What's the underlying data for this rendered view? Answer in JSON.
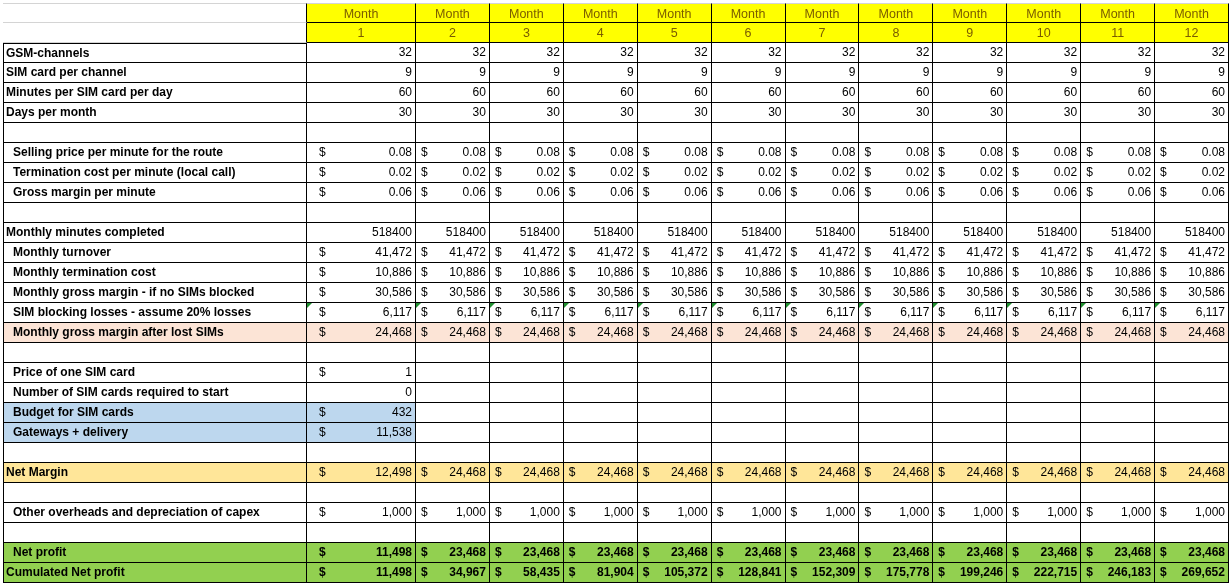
{
  "months": [
    {
      "label": "Month",
      "number": "1"
    },
    {
      "label": "Month",
      "number": "2"
    },
    {
      "label": "Month",
      "number": "3"
    },
    {
      "label": "Month",
      "number": "4"
    },
    {
      "label": "Month",
      "number": "5"
    },
    {
      "label": "Month",
      "number": "6"
    },
    {
      "label": "Month",
      "number": "7"
    },
    {
      "label": "Month",
      "number": "8"
    },
    {
      "label": "Month",
      "number": "9"
    },
    {
      "label": "Month",
      "number": "10"
    },
    {
      "label": "Month",
      "number": "11"
    },
    {
      "label": "Month",
      "number": "12"
    }
  ],
  "rows": [
    {
      "kind": "data",
      "label": "GSM-channels",
      "indent": false,
      "cells": [
        {
          "value": "32"
        },
        {
          "value": "32"
        },
        {
          "value": "32"
        },
        {
          "value": "32"
        },
        {
          "value": "32"
        },
        {
          "value": "32"
        },
        {
          "value": "32"
        },
        {
          "value": "32"
        },
        {
          "value": "32"
        },
        {
          "value": "32"
        },
        {
          "value": "32"
        },
        {
          "value": "32"
        }
      ]
    },
    {
      "kind": "data",
      "label": "SIM card per channel",
      "indent": false,
      "cells": [
        {
          "value": "9"
        },
        {
          "value": "9"
        },
        {
          "value": "9"
        },
        {
          "value": "9"
        },
        {
          "value": "9"
        },
        {
          "value": "9"
        },
        {
          "value": "9"
        },
        {
          "value": "9"
        },
        {
          "value": "9"
        },
        {
          "value": "9"
        },
        {
          "value": "9"
        },
        {
          "value": "9"
        }
      ]
    },
    {
      "kind": "data",
      "label": "Minutes per SIM card per day",
      "indent": false,
      "cells": [
        {
          "value": "60"
        },
        {
          "value": "60"
        },
        {
          "value": "60"
        },
        {
          "value": "60"
        },
        {
          "value": "60"
        },
        {
          "value": "60"
        },
        {
          "value": "60"
        },
        {
          "value": "60"
        },
        {
          "value": "60"
        },
        {
          "value": "60"
        },
        {
          "value": "60"
        },
        {
          "value": "60"
        }
      ]
    },
    {
      "kind": "data",
      "label": "Days per month",
      "indent": false,
      "cells": [
        {
          "value": "30"
        },
        {
          "value": "30"
        },
        {
          "value": "30"
        },
        {
          "value": "30"
        },
        {
          "value": "30"
        },
        {
          "value": "30"
        },
        {
          "value": "30"
        },
        {
          "value": "30"
        },
        {
          "value": "30"
        },
        {
          "value": "30"
        },
        {
          "value": "30"
        },
        {
          "value": "30"
        }
      ]
    },
    {
      "kind": "blank"
    },
    {
      "kind": "data",
      "label": "Selling price per minute for the route",
      "indent": true,
      "cells": [
        {
          "symbol": "$",
          "value": "0.08"
        },
        {
          "symbol": "$",
          "value": "0.08"
        },
        {
          "symbol": "$",
          "value": "0.08"
        },
        {
          "symbol": "$",
          "value": "0.08"
        },
        {
          "symbol": "$",
          "value": "0.08"
        },
        {
          "symbol": "$",
          "value": "0.08"
        },
        {
          "symbol": "$",
          "value": "0.08"
        },
        {
          "symbol": "$",
          "value": "0.08"
        },
        {
          "symbol": "$",
          "value": "0.08"
        },
        {
          "symbol": "$",
          "value": "0.08"
        },
        {
          "symbol": "$",
          "value": "0.08"
        },
        {
          "symbol": "$",
          "value": "0.08"
        }
      ]
    },
    {
      "kind": "data",
      "label": "Termination cost per minute (local call)",
      "indent": true,
      "cells": [
        {
          "symbol": "$",
          "value": "0.02"
        },
        {
          "symbol": "$",
          "value": "0.02"
        },
        {
          "symbol": "$",
          "value": "0.02"
        },
        {
          "symbol": "$",
          "value": "0.02"
        },
        {
          "symbol": "$",
          "value": "0.02"
        },
        {
          "symbol": "$",
          "value": "0.02"
        },
        {
          "symbol": "$",
          "value": "0.02"
        },
        {
          "symbol": "$",
          "value": "0.02"
        },
        {
          "symbol": "$",
          "value": "0.02"
        },
        {
          "symbol": "$",
          "value": "0.02"
        },
        {
          "symbol": "$",
          "value": "0.02"
        },
        {
          "symbol": "$",
          "value": "0.02"
        }
      ]
    },
    {
      "kind": "data",
      "label": "Gross margin per minute",
      "indent": true,
      "cells": [
        {
          "symbol": "$",
          "value": "0.06"
        },
        {
          "symbol": "$",
          "value": "0.06"
        },
        {
          "symbol": "$",
          "value": "0.06"
        },
        {
          "symbol": "$",
          "value": "0.06"
        },
        {
          "symbol": "$",
          "value": "0.06"
        },
        {
          "symbol": "$",
          "value": "0.06"
        },
        {
          "symbol": "$",
          "value": "0.06"
        },
        {
          "symbol": "$",
          "value": "0.06"
        },
        {
          "symbol": "$",
          "value": "0.06"
        },
        {
          "symbol": "$",
          "value": "0.06"
        },
        {
          "symbol": "$",
          "value": "0.06"
        },
        {
          "symbol": "$",
          "value": "0.06"
        }
      ]
    },
    {
      "kind": "blank"
    },
    {
      "kind": "data",
      "label": "Monthly minutes completed",
      "indent": false,
      "cells": [
        {
          "value": "518400"
        },
        {
          "value": "518400"
        },
        {
          "value": "518400"
        },
        {
          "value": "518400"
        },
        {
          "value": "518400"
        },
        {
          "value": "518400"
        },
        {
          "value": "518400"
        },
        {
          "value": "518400"
        },
        {
          "value": "518400"
        },
        {
          "value": "518400"
        },
        {
          "value": "518400"
        },
        {
          "value": "518400"
        }
      ]
    },
    {
      "kind": "data",
      "label": "Monthly turnover",
      "indent": true,
      "cells": [
        {
          "symbol": "$",
          "value": "41,472"
        },
        {
          "symbol": "$",
          "value": "41,472"
        },
        {
          "symbol": "$",
          "value": "41,472"
        },
        {
          "symbol": "$",
          "value": "41,472"
        },
        {
          "symbol": "$",
          "value": "41,472"
        },
        {
          "symbol": "$",
          "value": "41,472"
        },
        {
          "symbol": "$",
          "value": "41,472"
        },
        {
          "symbol": "$",
          "value": "41,472"
        },
        {
          "symbol": "$",
          "value": "41,472"
        },
        {
          "symbol": "$",
          "value": "41,472"
        },
        {
          "symbol": "$",
          "value": "41,472"
        },
        {
          "symbol": "$",
          "value": "41,472"
        }
      ]
    },
    {
      "kind": "data",
      "label": "Monthly termination cost",
      "indent": true,
      "cells": [
        {
          "symbol": "$",
          "value": "10,886"
        },
        {
          "symbol": "$",
          "value": "10,886"
        },
        {
          "symbol": "$",
          "value": "10,886"
        },
        {
          "symbol": "$",
          "value": "10,886"
        },
        {
          "symbol": "$",
          "value": "10,886"
        },
        {
          "symbol": "$",
          "value": "10,886"
        },
        {
          "symbol": "$",
          "value": "10,886"
        },
        {
          "symbol": "$",
          "value": "10,886"
        },
        {
          "symbol": "$",
          "value": "10,886"
        },
        {
          "symbol": "$",
          "value": "10,886"
        },
        {
          "symbol": "$",
          "value": "10,886"
        },
        {
          "symbol": "$",
          "value": "10,886"
        }
      ]
    },
    {
      "kind": "data",
      "label": "Monthly gross margin - if no SIMs blocked",
      "indent": true,
      "cells": [
        {
          "symbol": "$",
          "value": "30,586"
        },
        {
          "symbol": "$",
          "value": "30,586"
        },
        {
          "symbol": "$",
          "value": "30,586"
        },
        {
          "symbol": "$",
          "value": "30,586"
        },
        {
          "symbol": "$",
          "value": "30,586"
        },
        {
          "symbol": "$",
          "value": "30,586"
        },
        {
          "symbol": "$",
          "value": "30,586"
        },
        {
          "symbol": "$",
          "value": "30,586"
        },
        {
          "symbol": "$",
          "value": "30,586"
        },
        {
          "symbol": "$",
          "value": "30,586"
        },
        {
          "symbol": "$",
          "value": "30,586"
        },
        {
          "symbol": "$",
          "value": "30,586"
        }
      ]
    },
    {
      "kind": "data",
      "label": "SIM blocking losses - assume 20% losses",
      "indent": true,
      "flagged": true,
      "cells": [
        {
          "symbol": "$",
          "value": "6,117"
        },
        {
          "symbol": "$",
          "value": "6,117"
        },
        {
          "symbol": "$",
          "value": "6,117"
        },
        {
          "symbol": "$",
          "value": "6,117"
        },
        {
          "symbol": "$",
          "value": "6,117"
        },
        {
          "symbol": "$",
          "value": "6,117"
        },
        {
          "symbol": "$",
          "value": "6,117"
        },
        {
          "symbol": "$",
          "value": "6,117"
        },
        {
          "symbol": "$",
          "value": "6,117"
        },
        {
          "symbol": "$",
          "value": "6,117"
        },
        {
          "symbol": "$",
          "value": "6,117"
        },
        {
          "symbol": "$",
          "value": "6,117"
        }
      ]
    },
    {
      "kind": "data",
      "label": "Monthly gross margin after lost SIMs",
      "indent": true,
      "color": "#fce4d6",
      "cells": [
        {
          "symbol": "$",
          "value": "24,468"
        },
        {
          "symbol": "$",
          "value": "24,468"
        },
        {
          "symbol": "$",
          "value": "24,468"
        },
        {
          "symbol": "$",
          "value": "24,468"
        },
        {
          "symbol": "$",
          "value": "24,468"
        },
        {
          "symbol": "$",
          "value": "24,468"
        },
        {
          "symbol": "$",
          "value": "24,468"
        },
        {
          "symbol": "$",
          "value": "24,468"
        },
        {
          "symbol": "$",
          "value": "24,468"
        },
        {
          "symbol": "$",
          "value": "24,468"
        },
        {
          "symbol": "$",
          "value": "24,468"
        },
        {
          "symbol": "$",
          "value": "24,468"
        }
      ]
    },
    {
      "kind": "blank"
    },
    {
      "kind": "data",
      "label": "Price of one SIM card",
      "indent": true,
      "cells": [
        {
          "symbol": "$",
          "value": "1"
        }
      ]
    },
    {
      "kind": "data",
      "label": "Number of SIM cards required to start",
      "indent": true,
      "cells": [
        {
          "value": "0"
        }
      ]
    },
    {
      "kind": "data",
      "label": "Budget for SIM cards",
      "indent": true,
      "color": "#bdd7ee",
      "cells": [
        {
          "symbol": "$",
          "value": "432"
        }
      ]
    },
    {
      "kind": "data",
      "label": "Gateways + delivery",
      "indent": true,
      "color": "#bdd7ee",
      "cells": [
        {
          "symbol": "$",
          "value": "11,538"
        }
      ]
    },
    {
      "kind": "blank"
    },
    {
      "kind": "data",
      "label": "Net Margin",
      "indent": false,
      "color": "#ffe699",
      "cells": [
        {
          "symbol": "$",
          "value": "12,498"
        },
        {
          "symbol": "$",
          "value": "24,468"
        },
        {
          "symbol": "$",
          "value": "24,468"
        },
        {
          "symbol": "$",
          "value": "24,468"
        },
        {
          "symbol": "$",
          "value": "24,468"
        },
        {
          "symbol": "$",
          "value": "24,468"
        },
        {
          "symbol": "$",
          "value": "24,468"
        },
        {
          "symbol": "$",
          "value": "24,468"
        },
        {
          "symbol": "$",
          "value": "24,468"
        },
        {
          "symbol": "$",
          "value": "24,468"
        },
        {
          "symbol": "$",
          "value": "24,468"
        },
        {
          "symbol": "$",
          "value": "24,468"
        }
      ]
    },
    {
      "kind": "blank"
    },
    {
      "kind": "data",
      "label": "Other overheads and depreciation of capex",
      "indent": true,
      "cells": [
        {
          "symbol": "$",
          "value": "1,000"
        },
        {
          "symbol": "$",
          "value": "1,000"
        },
        {
          "symbol": "$",
          "value": "1,000"
        },
        {
          "symbol": "$",
          "value": "1,000"
        },
        {
          "symbol": "$",
          "value": "1,000"
        },
        {
          "symbol": "$",
          "value": "1,000"
        },
        {
          "symbol": "$",
          "value": "1,000"
        },
        {
          "symbol": "$",
          "value": "1,000"
        },
        {
          "symbol": "$",
          "value": "1,000"
        },
        {
          "symbol": "$",
          "value": "1,000"
        },
        {
          "symbol": "$",
          "value": "1,000"
        },
        {
          "symbol": "$",
          "value": "1,000"
        }
      ]
    },
    {
      "kind": "blank"
    },
    {
      "kind": "data",
      "label": "Net profit",
      "indent": true,
      "bold": true,
      "color": "#92d050",
      "cells": [
        {
          "symbol": "$",
          "value": "11,498"
        },
        {
          "symbol": "$",
          "value": "23,468"
        },
        {
          "symbol": "$",
          "value": "23,468"
        },
        {
          "symbol": "$",
          "value": "23,468"
        },
        {
          "symbol": "$",
          "value": "23,468"
        },
        {
          "symbol": "$",
          "value": "23,468"
        },
        {
          "symbol": "$",
          "value": "23,468"
        },
        {
          "symbol": "$",
          "value": "23,468"
        },
        {
          "symbol": "$",
          "value": "23,468"
        },
        {
          "symbol": "$",
          "value": "23,468"
        },
        {
          "symbol": "$",
          "value": "23,468"
        },
        {
          "symbol": "$",
          "value": "23,468"
        }
      ]
    },
    {
      "kind": "data",
      "label": "Cumulated Net profit",
      "indent": false,
      "bold": true,
      "color": "#92d050",
      "cells": [
        {
          "symbol": "$",
          "value": "11,498"
        },
        {
          "symbol": "$",
          "value": "34,967"
        },
        {
          "symbol": "$",
          "value": "58,435"
        },
        {
          "symbol": "$",
          "value": "81,904"
        },
        {
          "symbol": "$",
          "value": "105,372"
        },
        {
          "symbol": "$",
          "value": "128,841"
        },
        {
          "symbol": "$",
          "value": "152,309"
        },
        {
          "symbol": "$",
          "value": "175,778"
        },
        {
          "symbol": "$",
          "value": "199,246"
        },
        {
          "symbol": "$",
          "value": "222,715"
        },
        {
          "symbol": "$",
          "value": "246,183"
        },
        {
          "symbol": "$",
          "value": "269,652"
        }
      ]
    }
  ]
}
